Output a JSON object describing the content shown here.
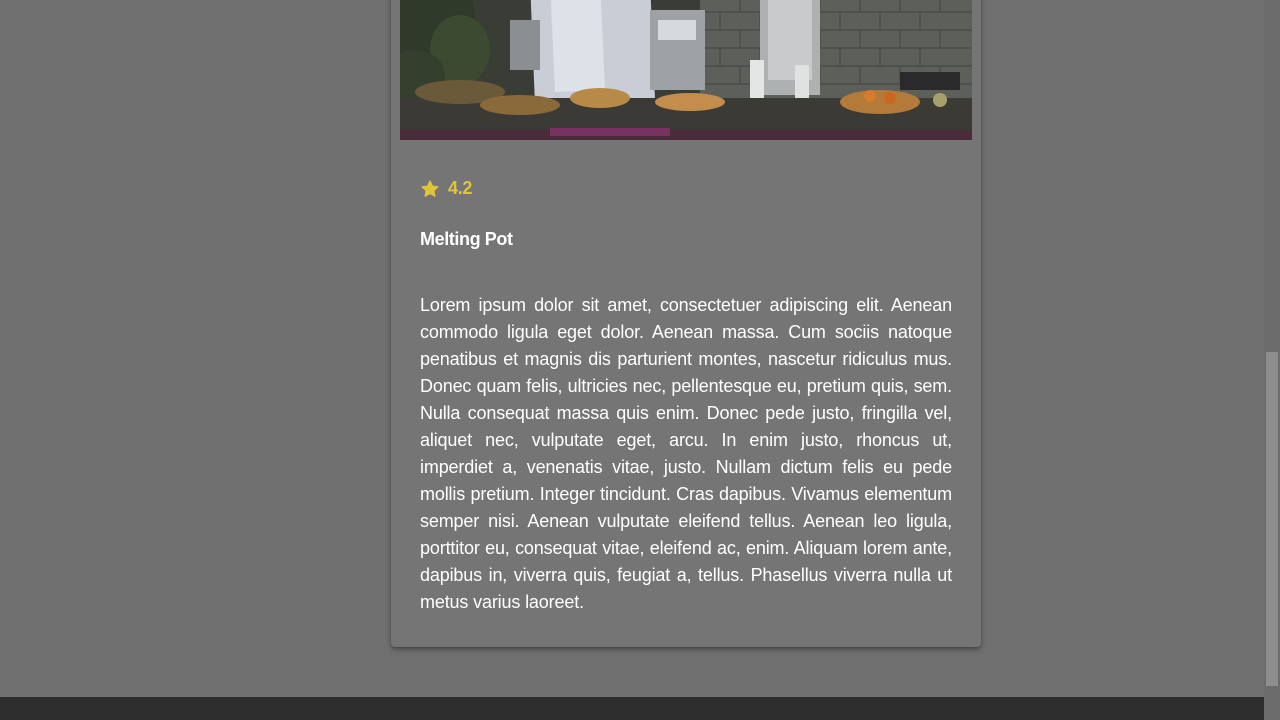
{
  "card": {
    "image_alt": "Chef in a busy kitchen",
    "rating": "4.2",
    "title": "Melting Pot",
    "description": "Lorem ipsum dolor sit amet, consectetuer adipiscing elit. Aenean commodo ligula eget dolor. Aenean massa. Cum sociis natoque penatibus et magnis dis parturient montes, nascetur ridiculus mus. Donec quam felis, ultricies nec, pellentesque eu, pretium quis, sem. Nulla consequat massa quis enim. Donec pede justo, fringilla vel, aliquet nec, vulputate eget, arcu. In enim justo, rhoncus ut, imperdiet a, venenatis vitae, justo. Nullam dictum felis eu pede mollis pretium. Integer tincidunt. Cras dapibus. Vivamus elementum semper nisi. Aenean vulputate eleifend tellus. Aenean leo ligula, porttitor eu, consequat vitae, eleifend ac, enim. Aliquam lorem ante, dapibus in, viverra quis, feugiat a, tellus. Phasellus viverra nulla ut metus varius laoreet.",
    "rating_icon": "star-icon"
  },
  "colors": {
    "page_background": "#707070",
    "card_background": "#757575",
    "rating_accent": "#e1c43d",
    "footer": "#2e2e2e"
  }
}
